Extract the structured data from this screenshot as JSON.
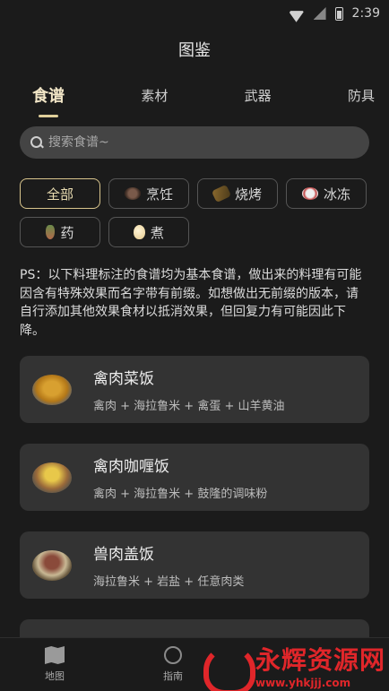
{
  "status_bar": {
    "time": "2:39"
  },
  "header": {
    "title": "图鉴"
  },
  "tabs": [
    {
      "label": "食谱",
      "active": true
    },
    {
      "label": "素材",
      "active": false
    },
    {
      "label": "武器",
      "active": false
    },
    {
      "label": "防具",
      "active": false
    }
  ],
  "search": {
    "placeholder": "搜索食谱~",
    "value": ""
  },
  "filters": [
    {
      "label": "全部",
      "icon": "",
      "active": true
    },
    {
      "label": "烹饪",
      "icon": "cooking-pot-icon",
      "active": false
    },
    {
      "label": "烧烤",
      "icon": "roast-icon",
      "active": false
    },
    {
      "label": "冰冻",
      "icon": "frozen-icon",
      "active": false
    },
    {
      "label": "药",
      "icon": "medicine-icon",
      "active": false
    },
    {
      "label": "煮",
      "icon": "egg-icon",
      "active": false
    }
  ],
  "note": "PS：以下料理标注的食谱均为基本食谱，做出来的料理有可能因含有特殊效果而名字带有前缀。如想做出无前缀的版本，请自行添加其他效果食材以抵消效果，但回复力有可能因此下降。",
  "recipes": [
    {
      "name": "禽肉菜饭",
      "ingredients": "禽肉 + 海拉鲁米 + 禽蛋 + 山羊黄油",
      "icon": "fried-rice-dish-icon"
    },
    {
      "name": "禽肉咖喱饭",
      "ingredients": "禽肉 + 海拉鲁米 + 鼓隆的调味粉",
      "icon": "curry-rice-dish-icon"
    },
    {
      "name": "兽肉盖饭",
      "ingredients": "海拉鲁米 + 岩盐 + 任意肉类",
      "icon": "meat-rice-bowl-icon"
    }
  ],
  "bottom_nav": [
    {
      "label": "地图",
      "icon": "map-icon"
    },
    {
      "label": "指南",
      "icon": "compass-icon"
    }
  ],
  "watermark": {
    "title": "永辉资源网",
    "url": "www.yhkjjj.com"
  }
}
